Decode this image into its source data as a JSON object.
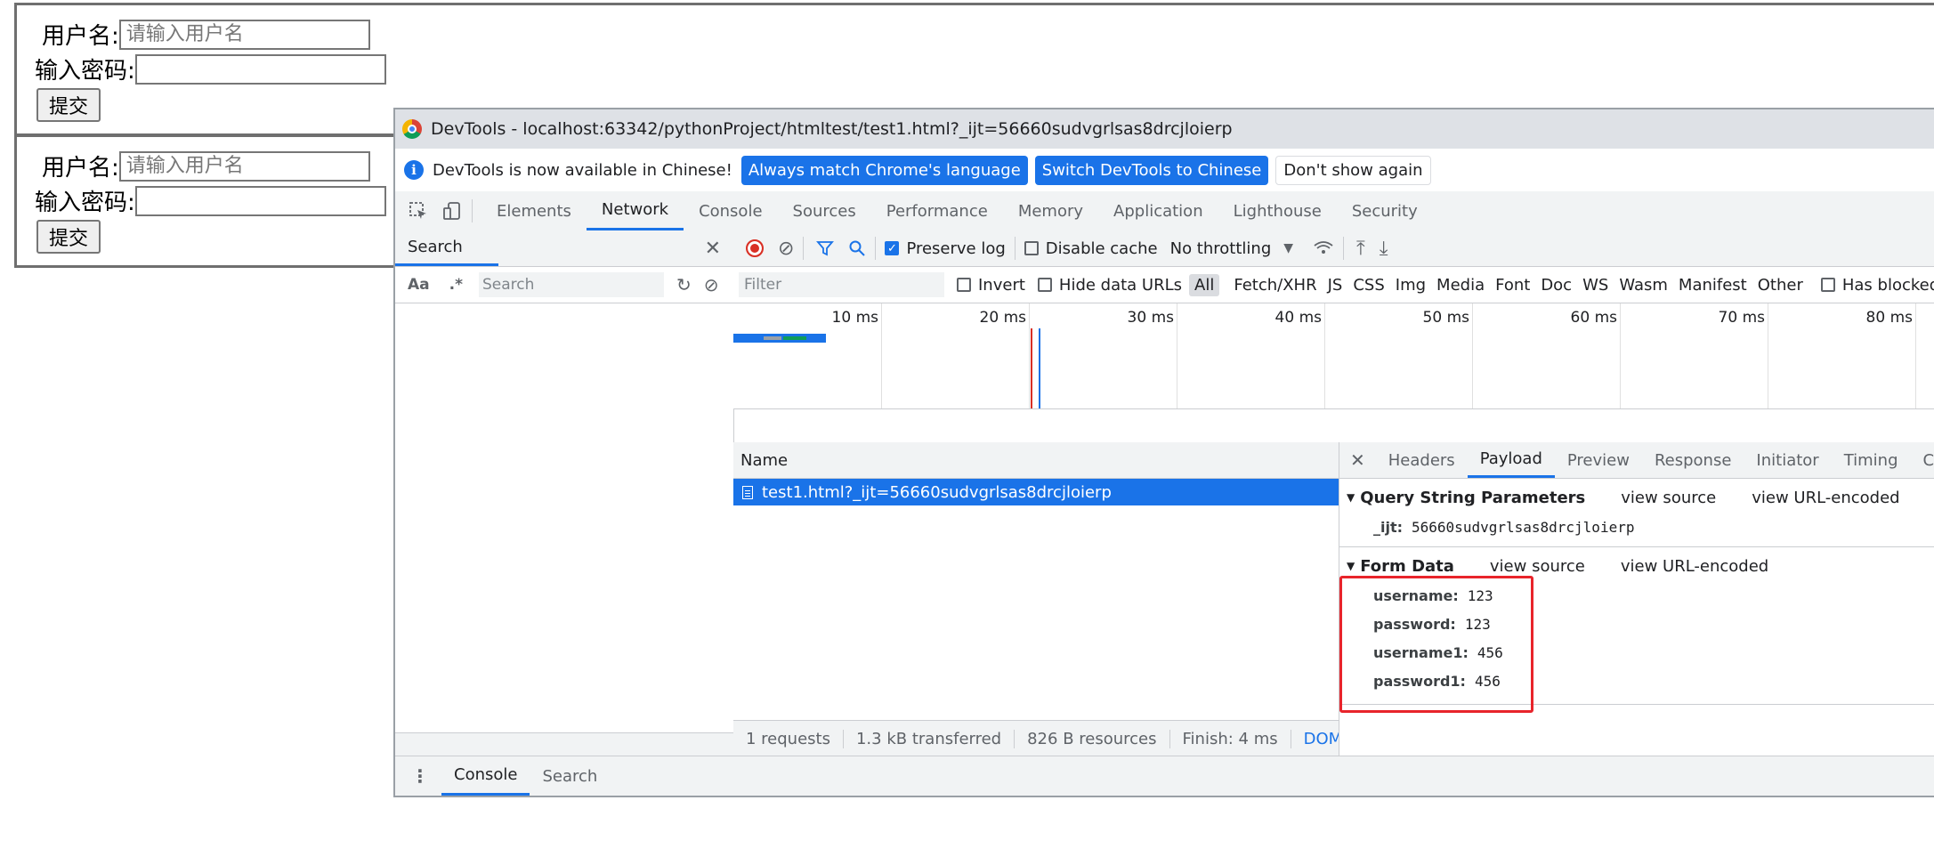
{
  "page_forms": [
    {
      "username_label": "用户名:",
      "username_placeholder": "请输入用户名",
      "password_label": "输入密码:",
      "submit_label": "提交"
    },
    {
      "username_label": "用户名:",
      "username_placeholder": "请输入用户名",
      "password_label": "输入密码:",
      "submit_label": "提交"
    }
  ],
  "devtools": {
    "window_title": "DevTools - localhost:63342/pythonProject/htmltest/test1.html?_ijt=56660sudvgrlsas8drcjloierp",
    "infobar": {
      "message": "DevTools is now available in Chinese!",
      "match_button": "Always match Chrome's language",
      "switch_button": "Switch DevTools to Chinese",
      "dismiss_button": "Don't show again"
    },
    "tabs": [
      "Elements",
      "Network",
      "Console",
      "Sources",
      "Performance",
      "Memory",
      "Application",
      "Lighthouse",
      "Security"
    ],
    "active_tab": "Network",
    "search_pane": {
      "title": "Search",
      "case_toggle": "Aa",
      "regex_toggle": ".*",
      "input_placeholder": "Search"
    },
    "toolbar": {
      "preserve_log": "Preserve log",
      "disable_cache": "Disable cache",
      "throttling": "No throttling"
    },
    "filterbar": {
      "placeholder": "Filter",
      "invert": "Invert",
      "hide_data_urls": "Hide data URLs",
      "types": [
        "All",
        "Fetch/XHR",
        "JS",
        "CSS",
        "Img",
        "Media",
        "Font",
        "Doc",
        "WS",
        "Wasm",
        "Manifest",
        "Other"
      ],
      "has_blocked": "Has blocked co"
    },
    "timeline_ticks": [
      "10 ms",
      "20 ms",
      "30 ms",
      "40 ms",
      "50 ms",
      "60 ms",
      "70 ms",
      "80 ms"
    ],
    "request_list": {
      "header": "Name",
      "rows": [
        "test1.html?_ijt=56660sudvgrlsas8drcjloierp"
      ]
    },
    "status_bar": [
      "1 requests",
      "1.3 kB transferred",
      "826 B resources",
      "Finish: 4 ms",
      "DOMContentl"
    ],
    "detail_tabs": [
      "Headers",
      "Payload",
      "Preview",
      "Response",
      "Initiator",
      "Timing",
      "Cookies"
    ],
    "active_detail_tab": "Payload",
    "query_section": {
      "title": "Query String Parameters",
      "view_source": "view source",
      "view_url_encoded": "view URL-encoded",
      "params": [
        {
          "key": "_ijt:",
          "value": "56660sudvgrlsas8drcjloierp"
        }
      ]
    },
    "form_section": {
      "title": "Form Data",
      "view_source": "view source",
      "view_url_encoded": "view URL-encoded",
      "params": [
        {
          "key": "username:",
          "value": "123"
        },
        {
          "key": "password:",
          "value": "123"
        },
        {
          "key": "username1:",
          "value": "456"
        },
        {
          "key": "password1:",
          "value": "456"
        }
      ]
    },
    "drawer_tabs": [
      "Console",
      "Search"
    ],
    "active_drawer_tab": "Console"
  },
  "colors": {
    "accent": "#1a73e8",
    "highlight": "#e8242b",
    "record": "#d93025"
  }
}
